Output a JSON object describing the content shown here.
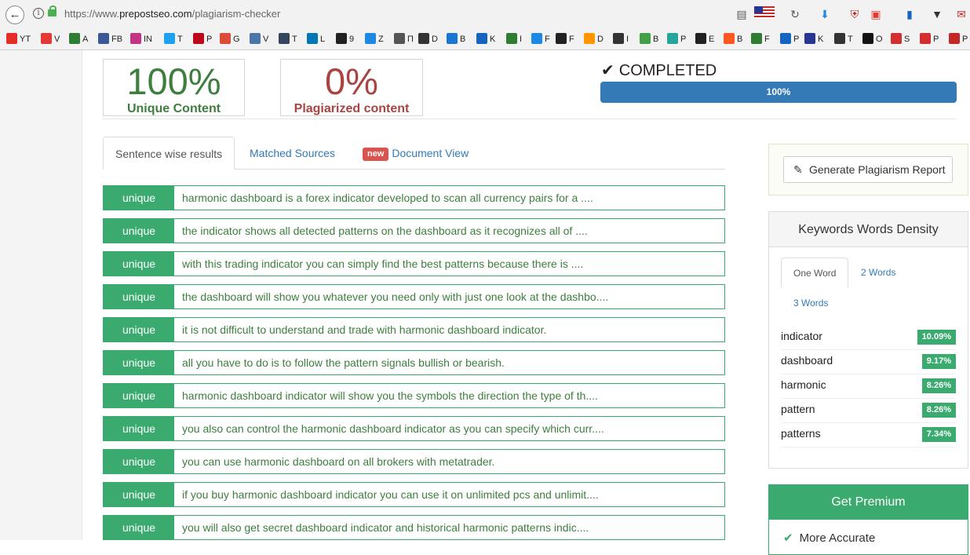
{
  "browser": {
    "url_prefix": "https://www.",
    "url_domain": "prepostseo.com",
    "url_path": "/plagiarism-checker",
    "bookmarks": [
      {
        "label": "YT",
        "color": "#e52d27"
      },
      {
        "label": "V",
        "color": "#e53935"
      },
      {
        "label": "A",
        "color": "#2e7d32"
      },
      {
        "label": "FB",
        "color": "#3b5998"
      },
      {
        "label": "IN",
        "color": "#c13584"
      },
      {
        "label": "T",
        "color": "#1da1f2"
      },
      {
        "label": "P",
        "color": "#bd081c"
      },
      {
        "label": "G",
        "color": "#dd4b39"
      },
      {
        "label": "V",
        "color": "#4a76a8"
      },
      {
        "label": "T",
        "color": "#35465c"
      },
      {
        "label": "L",
        "color": "#0077b5"
      },
      {
        "label": "9",
        "color": "#222222"
      },
      {
        "label": "Z",
        "color": "#1e88e5"
      },
      {
        "label": "П",
        "color": "#555555"
      },
      {
        "label": "D",
        "color": "#333333"
      },
      {
        "label": "B",
        "color": "#1976d2"
      },
      {
        "label": "K",
        "color": "#1565c0"
      },
      {
        "label": "I",
        "color": "#2e7d32"
      },
      {
        "label": "F",
        "color": "#1e88e5"
      },
      {
        "label": "F",
        "color": "#222222"
      },
      {
        "label": "D",
        "color": "#ff9800"
      },
      {
        "label": "I",
        "color": "#333333"
      },
      {
        "label": "B",
        "color": "#43a047"
      },
      {
        "label": "P",
        "color": "#26a69a"
      },
      {
        "label": "E",
        "color": "#212121"
      },
      {
        "label": "B",
        "color": "#ff5722"
      },
      {
        "label": "F",
        "color": "#2e7d32"
      },
      {
        "label": "P",
        "color": "#1565c0"
      },
      {
        "label": "K",
        "color": "#283593"
      },
      {
        "label": "T",
        "color": "#333333"
      },
      {
        "label": "O",
        "color": "#111111"
      },
      {
        "label": "S",
        "color": "#d32f2f"
      },
      {
        "label": "P",
        "color": "#d32f2f"
      },
      {
        "label": "P",
        "color": "#c62828"
      }
    ]
  },
  "summary": {
    "unique_value": "100%",
    "unique_label": "Unique Content",
    "plag_value": "0%",
    "plag_label": "Plagiarized content",
    "status": "COMPLETED",
    "progress_text": "100%",
    "progress": 1.0
  },
  "tabs": {
    "sentence": "Sentence wise results",
    "matched": "Matched Sources",
    "new_badge": "new",
    "document": "Document View"
  },
  "results": [
    {
      "tag": "unique",
      "text": "harmonic dashboard is a forex indicator developed to scan all currency pairs for a ...."
    },
    {
      "tag": "unique",
      "text": "the indicator shows all detected patterns on the dashboard as it recognizes all of ...."
    },
    {
      "tag": "unique",
      "text": "with this trading indicator you can simply find the best patterns because there is ...."
    },
    {
      "tag": "unique",
      "text": "the dashboard will show you whatever you need only with just one look at the dashbo...."
    },
    {
      "tag": "unique",
      "text": "it is not difficult to understand and trade with harmonic dashboard indicator."
    },
    {
      "tag": "unique",
      "text": "all you have to do is to follow the pattern signals bullish or bearish."
    },
    {
      "tag": "unique",
      "text": "harmonic dashboard indicator will show you the symbols the direction the type of th...."
    },
    {
      "tag": "unique",
      "text": "you also can control the harmonic dashboard indicator as you can specify which curr...."
    },
    {
      "tag": "unique",
      "text": "you can use harmonic dashboard on all brokers with metatrader."
    },
    {
      "tag": "unique",
      "text": "if you buy harmonic dashboard indicator you can use it on unlimited pcs and unlimit...."
    },
    {
      "tag": "unique",
      "text": "you will also get secret dashboard indicator and historical harmonic patterns indic...."
    }
  ],
  "report": {
    "button": "Generate Plagiarism Report"
  },
  "keywords": {
    "title": "Keywords Words Density",
    "tab_one": "One Word",
    "tab_two": "2 Words",
    "tab_three": "3 Words",
    "rows": [
      {
        "word": "indicator",
        "pct": "10.09%"
      },
      {
        "word": "dashboard",
        "pct": "9.17%"
      },
      {
        "word": "harmonic",
        "pct": "8.26%"
      },
      {
        "word": "pattern",
        "pct": "8.26%"
      },
      {
        "word": "patterns",
        "pct": "7.34%"
      }
    ]
  },
  "premium": {
    "title": "Get Premium",
    "item": "More Accurate"
  }
}
